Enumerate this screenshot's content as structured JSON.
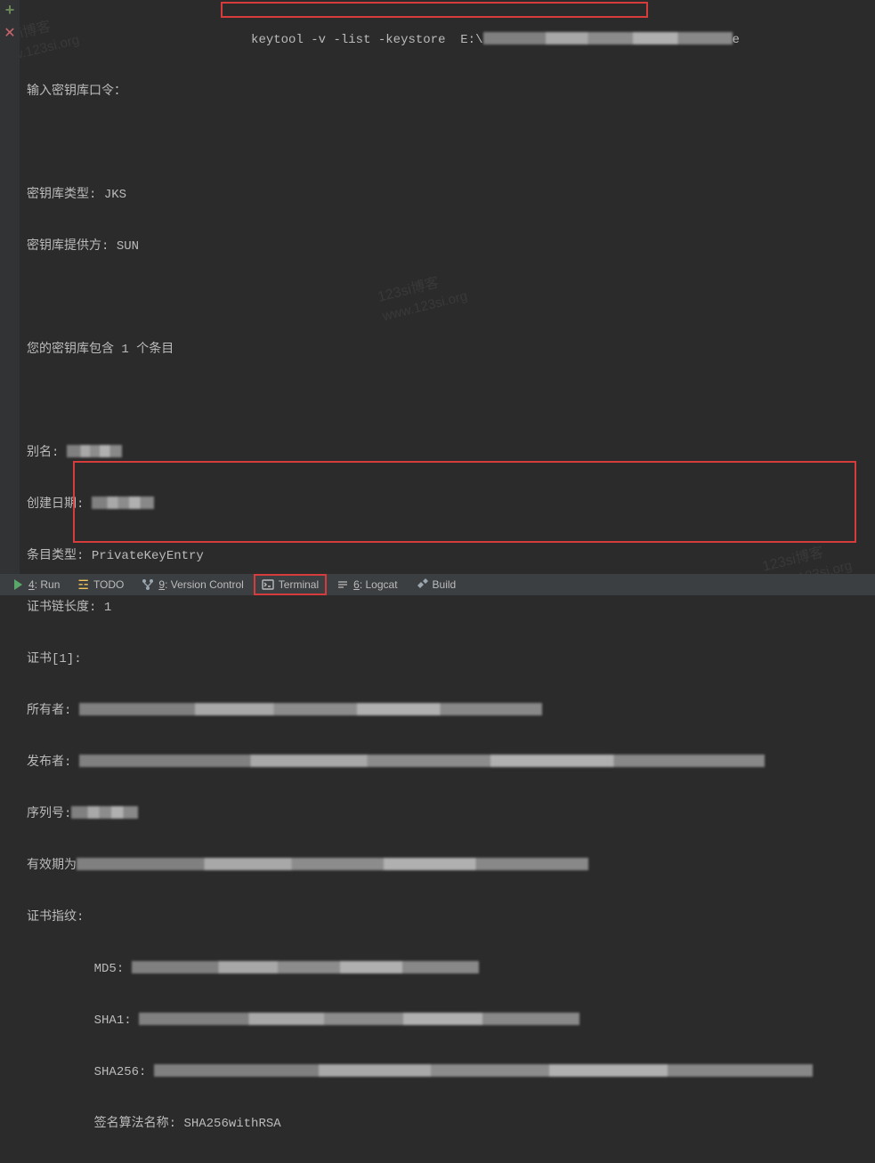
{
  "gutter": {
    "plus": "+",
    "x": "✕"
  },
  "command_line": "keytool -v -list -keystore  E:\\",
  "command_line_suffix": "e",
  "terminal": {
    "enter_password": "输入密钥库口令：",
    "keystore_type_label": "密钥库类型: ",
    "keystore_type_value": "JKS",
    "keystore_provider_label": "密钥库提供方: ",
    "keystore_provider_value": "SUN",
    "entry_count_line": "您的密钥库包含 1 个条目",
    "alias_label": "别名: ",
    "created_label": "创建日期: ",
    "entry_type_label": "条目类型: ",
    "entry_type_value": "PrivateKeyEntry",
    "chain_length_label": "证书链长度: ",
    "chain_length_value": "1",
    "cert_index": "证书[1]:",
    "owner_label": "所有者: ",
    "issuer_label": "发布者: ",
    "serial_label": "序列号:",
    "validity_label": "有效期为",
    "fingerprint_label": "证书指纹:",
    "md5_label": "MD5: ",
    "sha1_label": "SHA1: ",
    "sha256_label": "SHA256: ",
    "sig_alg_label": "签名算法名称: ",
    "sig_alg_value": "SHA256withRSA"
  },
  "tabs": {
    "run_num": "4",
    "run_label": ": Run",
    "todo_label": "TODO",
    "vc_num": "9",
    "vc_label": ": Version Control",
    "term_label": "Terminal",
    "logcat_num": "6",
    "logcat_label": ": Logcat",
    "build_label": "Build"
  },
  "watermark_line1": "123si博客",
  "watermark_line2": "www.123si.org"
}
